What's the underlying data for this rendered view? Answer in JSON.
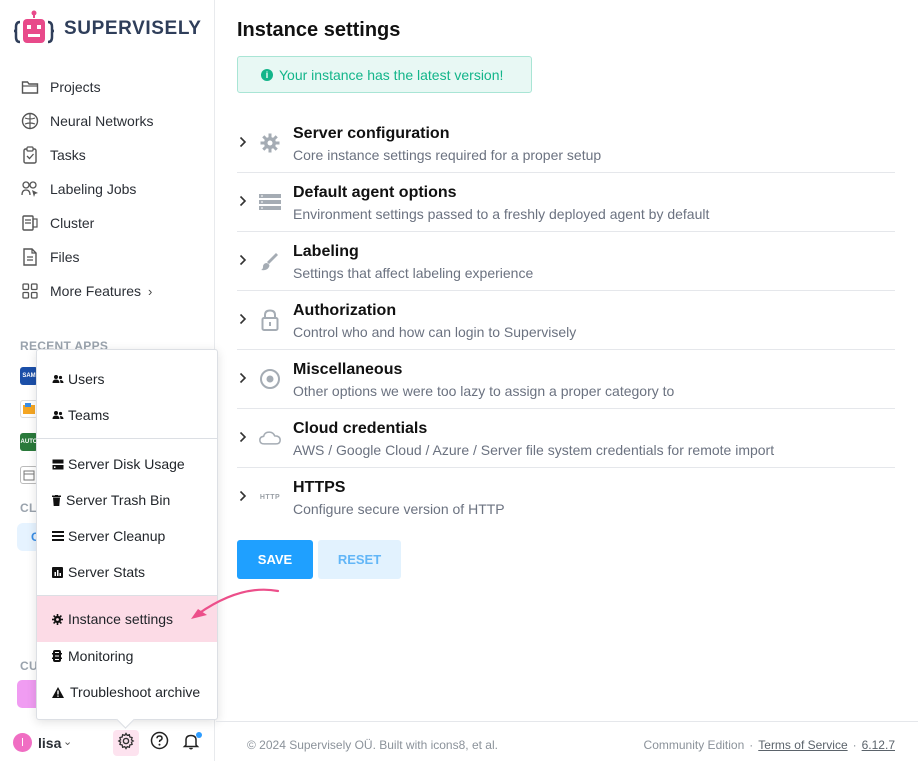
{
  "brand": {
    "name": "SUPERVISELY",
    "accent": "#e84a8a"
  },
  "sidebar": {
    "items": [
      {
        "label": "Projects",
        "icon": "folder-icon"
      },
      {
        "label": "Neural Networks",
        "icon": "brain-icon"
      },
      {
        "label": "Tasks",
        "icon": "clipboard-icon"
      },
      {
        "label": "Labeling Jobs",
        "icon": "labeling-jobs-icon"
      },
      {
        "label": "Cluster",
        "icon": "cluster-icon"
      },
      {
        "label": "Files",
        "icon": "file-icon"
      },
      {
        "label": "More Features",
        "icon": "grid-icon"
      }
    ],
    "recent_apps_label": "RECENT APPS",
    "cl_label": "CL",
    "cl_chip": "C",
    "cu_label": "CU"
  },
  "popup_menu": {
    "items": [
      {
        "label": "Users",
        "icon": "users-icon"
      },
      {
        "label": "Teams",
        "icon": "teams-icon"
      },
      {
        "label": "Server Disk Usage",
        "icon": "disk-icon"
      },
      {
        "label": "Server Trash Bin",
        "icon": "trash-icon"
      },
      {
        "label": "Server Cleanup",
        "icon": "list-icon"
      },
      {
        "label": "Server Stats",
        "icon": "stats-icon"
      },
      {
        "label": "Instance settings",
        "icon": "gear-icon",
        "active": true
      },
      {
        "label": "Monitoring",
        "icon": "monitoring-icon"
      },
      {
        "label": "Troubleshoot archive",
        "icon": "warning-icon"
      }
    ]
  },
  "user": {
    "name": "lisa",
    "initial": "l"
  },
  "main": {
    "title": "Instance settings",
    "alert": "Your instance has the latest version!",
    "sections": [
      {
        "title": "Server configuration",
        "desc": "Core instance settings required for a proper setup",
        "icon": "gear-icon"
      },
      {
        "title": "Default agent options",
        "desc": "Environment settings passed to a freshly deployed agent by default",
        "icon": "server-icon"
      },
      {
        "title": "Labeling",
        "desc": "Settings that affect labeling experience",
        "icon": "brush-icon"
      },
      {
        "title": "Authorization",
        "desc": "Control who and how can login to Supervisely",
        "icon": "lock-icon"
      },
      {
        "title": "Miscellaneous",
        "desc": "Other options we were too lazy to assign a proper category to",
        "icon": "circle-dot-icon"
      },
      {
        "title": "Cloud credentials",
        "desc": "AWS / Google Cloud / Azure / Server file system credentials for remote import",
        "icon": "cloud-icon"
      },
      {
        "title": "HTTPS",
        "desc": "Configure secure version of HTTP",
        "icon": "https-icon",
        "icon_text": "HTTP"
      }
    ],
    "save_label": "SAVE",
    "reset_label": "RESET"
  },
  "footer": {
    "copyright": "© 2024 Supervisely OÜ. Built with icons8, et al.",
    "edition": "Community Edition",
    "tos": "Terms of Service",
    "version": "6.12.7"
  }
}
